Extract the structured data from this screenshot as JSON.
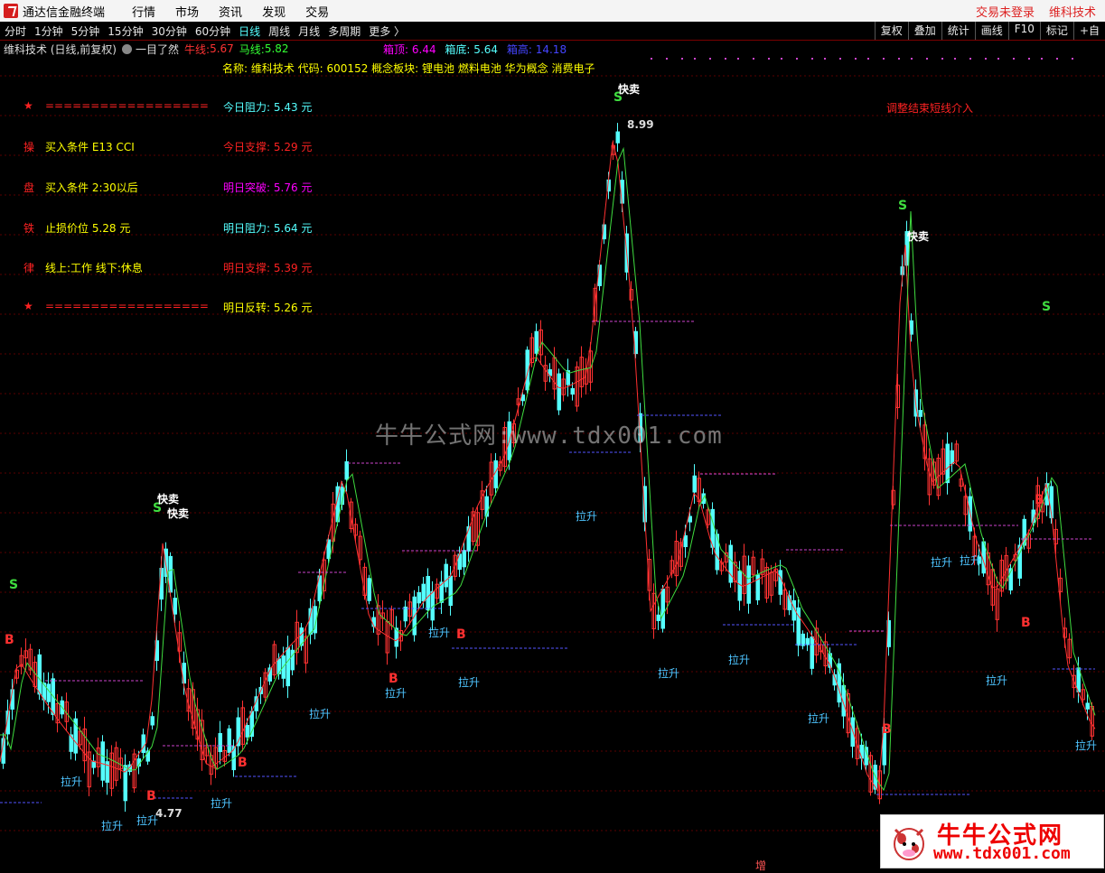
{
  "app": {
    "title": "通达信金融终端"
  },
  "menu": [
    "行情",
    "市场",
    "资讯",
    "发现",
    "交易"
  ],
  "menu_right": [
    "交易未登录",
    "维科技术"
  ],
  "periods": [
    "分时",
    "1分钟",
    "5分钟",
    "15分钟",
    "30分钟",
    "60分钟",
    "日线",
    "周线",
    "月线",
    "多周期",
    "更多 〉"
  ],
  "active_period": "日线",
  "tools_right": [
    "复权",
    "叠加",
    "统计",
    "画线",
    "F10",
    "标记",
    "+自"
  ],
  "header": {
    "stock_title": "维科技术 (日线,前复权)",
    "indicator_name": "一目了然",
    "niu_label": "牛线:",
    "niu_value": "5.67",
    "ma_label": "马线:",
    "ma_value": "5.82",
    "box_top_label": "箱顶:",
    "box_top_value": "6.44",
    "box_bottom_label": "箱底:",
    "box_bottom_value": "5.64",
    "box_high_label": "箱高:",
    "box_high_value": "14.18"
  },
  "info_line": "名称: 维科技术 代码: 600152 概念板块: 锂电池 燃料电池 华为概念 消费电子",
  "left_panel": [
    {
      "k": "★",
      "v": "=================="
    },
    {
      "k": "操",
      "v": "买入条件 E13 CCI"
    },
    {
      "k": "盘",
      "v": "买入条件 2:30以后"
    },
    {
      "k": "铁",
      "v": "止损价位 5.28 元"
    },
    {
      "k": "律",
      "v": "线上:工作 线下:休息"
    },
    {
      "k": "★",
      "v": "=================="
    }
  ],
  "mid_panel": [
    {
      "label": "今日阻力:",
      "value": "5.43 元",
      "color": "#5ff"
    },
    {
      "label": "今日支撑:",
      "value": "5.29 元",
      "color": "#f22"
    },
    {
      "label": "明日突破:",
      "value": "5.76 元",
      "color": "#f0f"
    },
    {
      "label": "明日阻力:",
      "value": "5.64 元",
      "color": "#5ff"
    },
    {
      "label": "明日支撑:",
      "value": "5.39 元",
      "color": "#f22"
    },
    {
      "label": "明日反转:",
      "value": "5.26 元",
      "color": "#ff0"
    }
  ],
  "note": "调整结束短线介入",
  "watermark": "牛牛公式网:www.tdx001.com",
  "badge": {
    "line1": "牛牛公式网",
    "line2": "www.tdx001.com"
  },
  "bottom_label": "增",
  "chart_data": {
    "type": "candlestick",
    "max_price_label": "8.99",
    "min_price_label": "4.77",
    "signal_texts": {
      "buy": "B",
      "sell": "S",
      "quick_sell": "快卖",
      "pull_up": "拉升"
    }
  },
  "colors": {
    "up": "#ff3232",
    "down": "#54ffff",
    "ma_fast": "#ff3030",
    "ma_slow": "#3fdc3f",
    "box": "#cc44cc",
    "support": "#5555ff"
  }
}
